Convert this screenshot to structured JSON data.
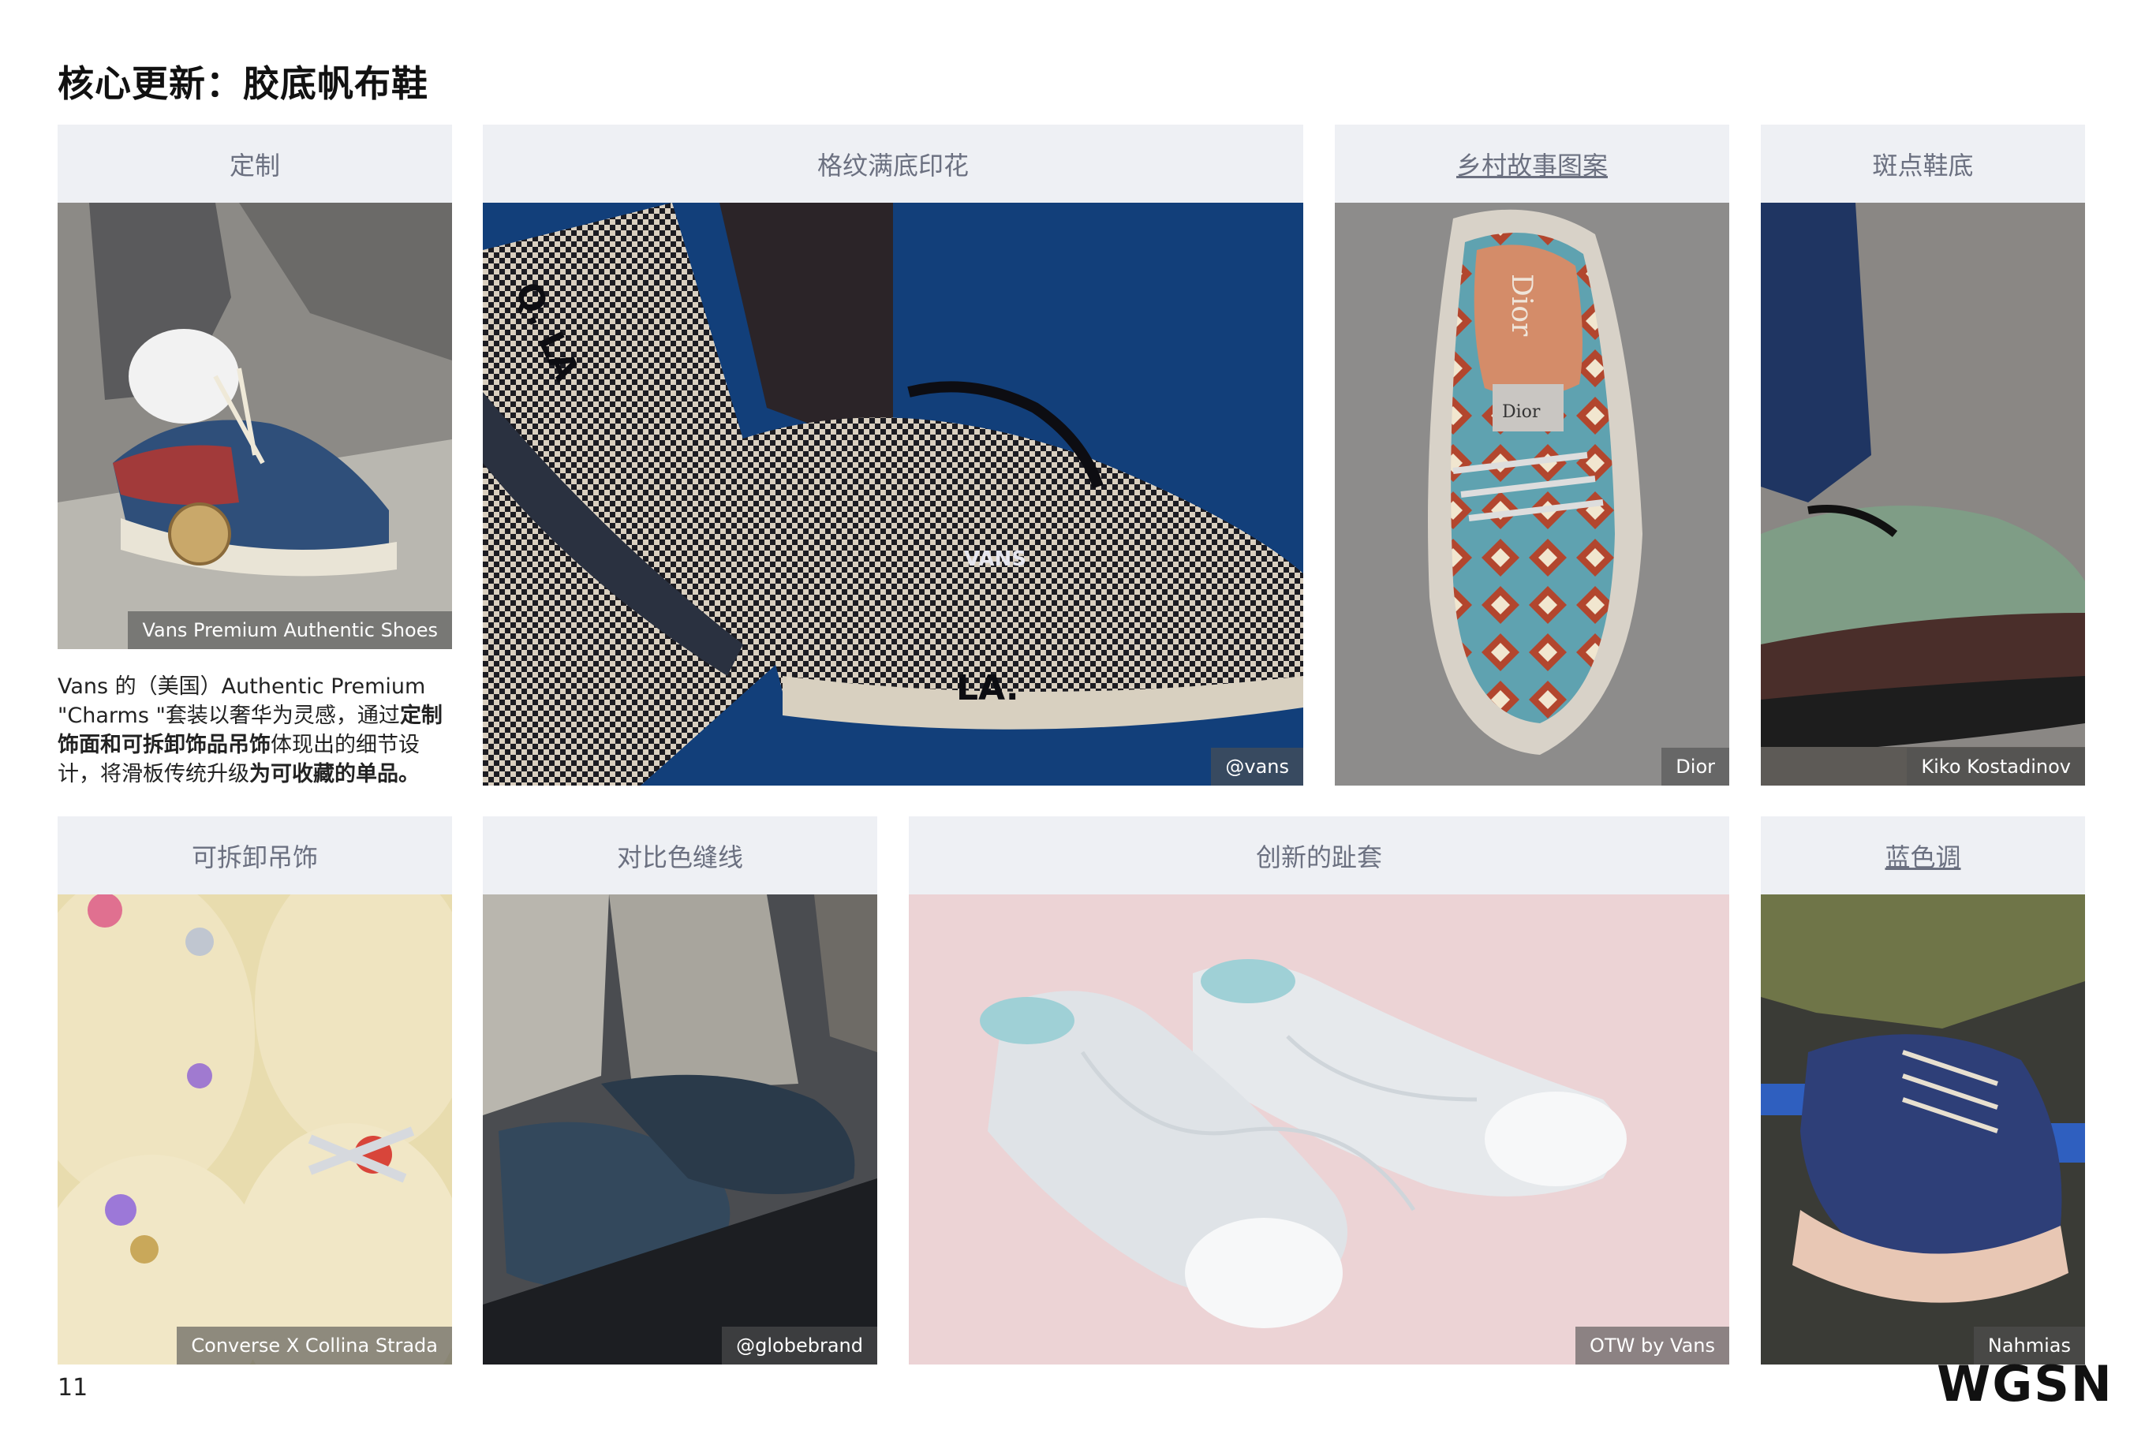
{
  "page": {
    "title": "核心更新：胶底帆布鞋",
    "page_number": "11",
    "logo_text": "WGSN"
  },
  "description": {
    "part1": "Vans 的（美国）Authentic Premium \"Charms \"套装以奢华为灵感，通过",
    "bold1": "定制饰面和可拆卸饰品吊饰",
    "part2": "体现出的细节设计，将滑板传统升级",
    "bold2": "为可收藏的单品。"
  },
  "cards": [
    {
      "title": "定制",
      "credit": "Vans Premium Authentic Shoes"
    },
    {
      "title": "格纹满底印花",
      "credit": "@vans"
    },
    {
      "title": "乡村故事图案",
      "credit": "Dior"
    },
    {
      "title": "斑点鞋底",
      "credit": "Kiko Kostadinov"
    },
    {
      "title": "可拆卸吊饰",
      "credit": "Converse X Collina Strada"
    },
    {
      "title": "对比色缝线",
      "credit": "@globebrand"
    },
    {
      "title": "创新的趾套",
      "credit": "OTW by Vans"
    },
    {
      "title": "蓝色调",
      "credit": "Nahmias"
    }
  ],
  "photo_texts": {
    "vans_side": "VANS",
    "la_sole": "LA.",
    "la_side": "Q. LA",
    "dior_insole": "Dior",
    "dior_tongue": "Dior"
  },
  "colors": {
    "header_bg": "#eef0f4",
    "header_text": "#6b7080",
    "credit_bg": "#505050"
  }
}
